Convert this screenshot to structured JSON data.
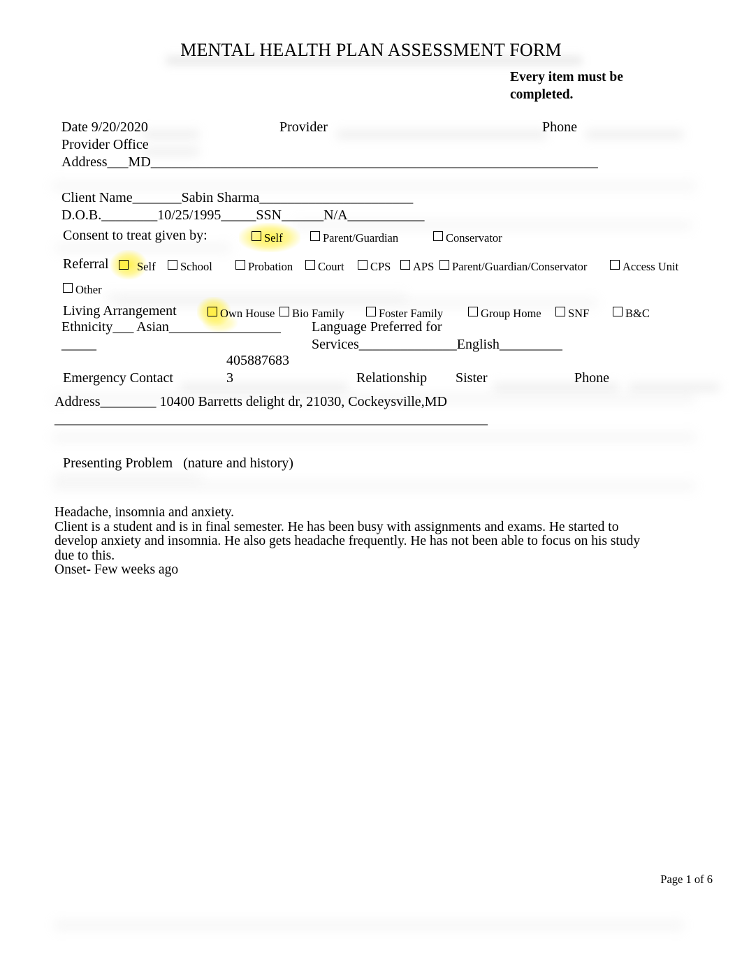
{
  "document": {
    "title": "MENTAL HEALTH PLAN ASSESSMENT FORM",
    "instruction": "Every item must be completed.",
    "footer": "Page 1 of 6"
  },
  "provider_section": {
    "date_label": "Date",
    "date_value": "9/20/2020",
    "provider_label": "Provider",
    "provider_value": "",
    "phone_label": "Phone",
    "phone_value": "",
    "office_address_label": "Provider Office Address",
    "office_address_prefix": "___",
    "office_address_value": "MD",
    "office_address_rule": "________________________________________________________________"
  },
  "client_section": {
    "name_label": "Client Name",
    "name_lead": "_______",
    "name_value": "Sabin Sharma",
    "name_trail": "______________________",
    "dob_label": "D.O.B.",
    "dob_lead": "________",
    "dob_value": "10/25/1995",
    "dob_trail": "_____",
    "ssn_label": "SSN",
    "ssn_lead": "______",
    "ssn_value": "N/A",
    "ssn_trail": "___________"
  },
  "consent": {
    "label": "Consent to treat given by:",
    "options": [
      {
        "label": "Self",
        "checked": false,
        "highlighted": true
      },
      {
        "label": "Parent/Guardian",
        "checked": false,
        "highlighted": false
      },
      {
        "label": "Conservator",
        "checked": false,
        "highlighted": false
      }
    ]
  },
  "referral": {
    "label": "Referral",
    "options": [
      {
        "label": "Self",
        "checked": false,
        "highlighted": true
      },
      {
        "label": "School",
        "checked": false,
        "highlighted": false
      },
      {
        "label": "Probation",
        "checked": false,
        "highlighted": false
      },
      {
        "label": "Court",
        "checked": false,
        "highlighted": false
      },
      {
        "label": "CPS",
        "checked": false,
        "highlighted": false
      },
      {
        "label": "APS",
        "checked": false,
        "highlighted": false
      },
      {
        "label": "Parent/Guardian/Conservator",
        "checked": false,
        "highlighted": false
      },
      {
        "label": "Access Unit",
        "checked": false,
        "highlighted": false
      },
      {
        "label": "Other",
        "checked": false,
        "highlighted": false
      }
    ]
  },
  "living_arrangement": {
    "label": "Living   Arrangement",
    "options": [
      {
        "label": "Own House",
        "checked": false,
        "highlighted": true
      },
      {
        "label": "Bio Family",
        "checked": false,
        "highlighted": false
      },
      {
        "label": "Foster Family",
        "checked": false,
        "highlighted": false
      },
      {
        "label": "Group Home",
        "checked": false,
        "highlighted": false
      },
      {
        "label": "SNF",
        "checked": false,
        "highlighted": false
      },
      {
        "label": "B&C",
        "checked": false,
        "highlighted": false
      }
    ]
  },
  "ethnicity": {
    "label": "Ethnicity",
    "lead": "___",
    "value": "Asian",
    "trail": "________________",
    "wrap_rule": "_____"
  },
  "language": {
    "label_line1": "Language Preferred for",
    "label_line2": "Services",
    "lead": "______________",
    "value": "English",
    "trail": "_________"
  },
  "emergency_contact": {
    "label": "Emergency Contact",
    "value_line1": "405887683",
    "value_line2": "3",
    "relationship_label": "Relationship",
    "relationship_value": "Sister",
    "phone_label": "Phone",
    "phone_value": "",
    "address_label": "Address",
    "address_lead": "________",
    "address_value": "10400 Barretts delight dr, 21030, Cockeysville,MD",
    "address_rule": "______________________________________________________________"
  },
  "presenting_problem": {
    "heading": "Presenting Problem",
    "subheading": "(nature and history)",
    "lines": [
      "Headache, insomnia and anxiety.",
      "Client is a student and is in final semester. He has been busy with assignments and exams. He started to",
      "develop anxiety and insomnia. He also gets headache frequently. He has not been able to focus on his study",
      "due to this.",
      "Onset- Few weeks ago"
    ]
  }
}
